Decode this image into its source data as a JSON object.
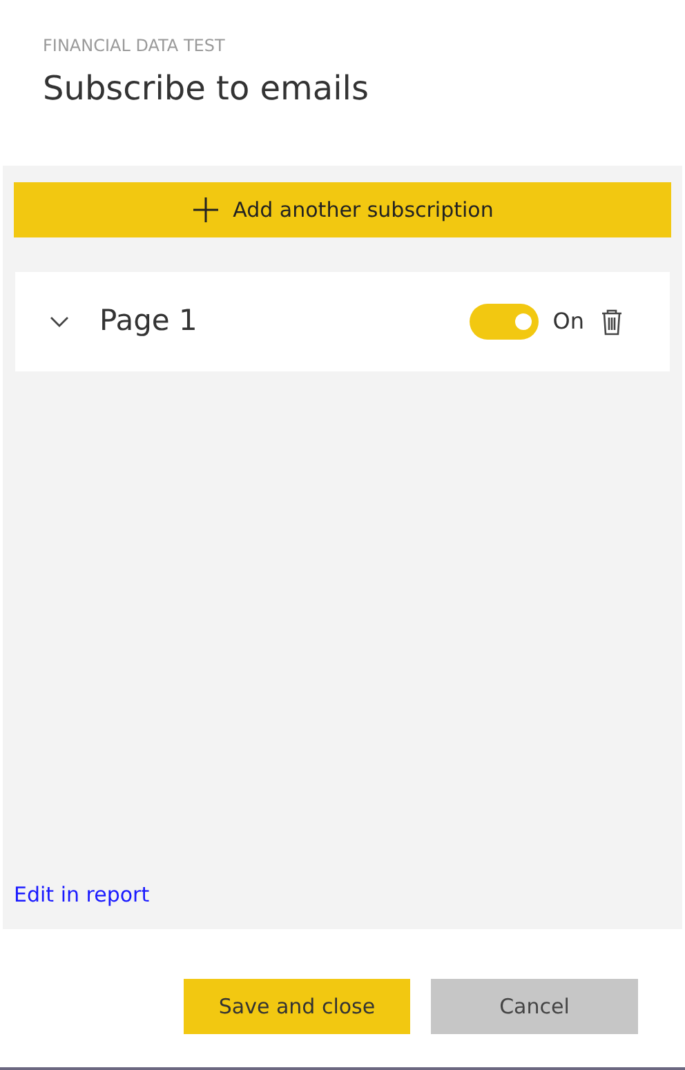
{
  "dialog": {
    "subtitle": "FINANCIAL DATA TEST",
    "title": "Subscribe to emails"
  },
  "add_button": {
    "label": "Add another subscription"
  },
  "subscriptions": [
    {
      "name": "Page 1",
      "expanded": false,
      "on": true,
      "toggle_label": "On"
    }
  ],
  "edit_link": "Edit in report",
  "buttons": [
    {
      "label": "Save and close",
      "kind": "primary"
    },
    {
      "label": "Cancel",
      "kind": "secondary"
    }
  ]
}
